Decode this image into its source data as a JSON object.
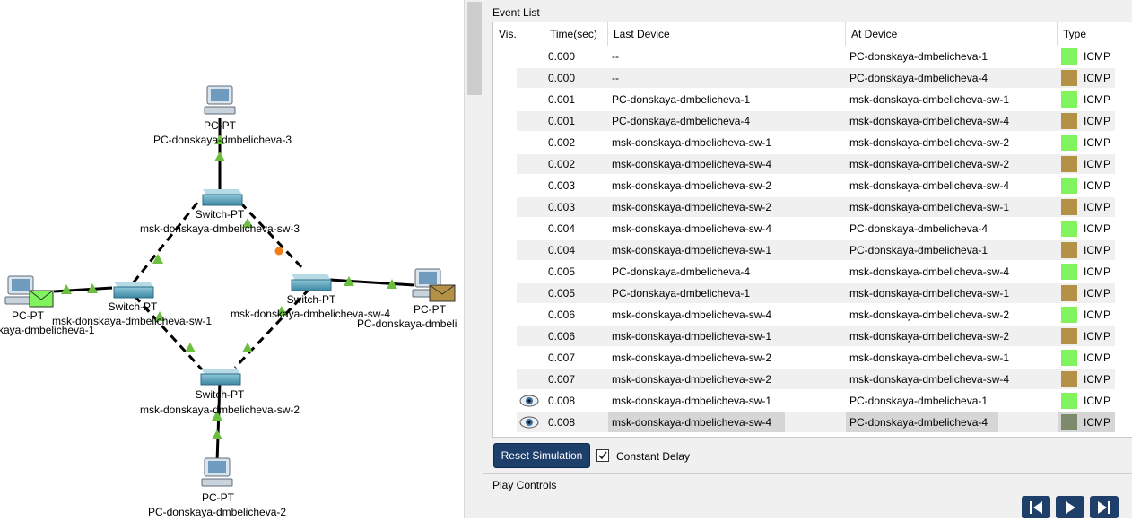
{
  "topology": {
    "devices": [
      {
        "kind": "pc",
        "type_label": "PC-PT",
        "name": "PC-donskaya-dmbelicheva-3"
      },
      {
        "kind": "switch",
        "type_label": "Switch-PT",
        "name": "msk-donskaya-dmbelicheva-sw-3"
      },
      {
        "kind": "pc",
        "type_label": "PC-PT",
        "name": "kaya-dmbelicheva-1"
      },
      {
        "kind": "switch",
        "type_label": "Switch-PT",
        "name": "msk-donskaya-dmbelicheva-sw-1"
      },
      {
        "kind": "switch",
        "type_label": "Switch-PT",
        "name": "msk-donskaya-dmbelicheva-sw-4"
      },
      {
        "kind": "pc",
        "type_label": "PC-PT",
        "name": "PC-donskaya-dmbeli"
      },
      {
        "kind": "switch",
        "type_label": "Switch-PT",
        "name": "msk-donskaya-dmbelicheva-sw-2"
      },
      {
        "kind": "pc",
        "type_label": "PC-PT",
        "name": "PC-donskaya-dmbelicheva-2"
      }
    ]
  },
  "event_list": {
    "title": "Event List",
    "columns": [
      "Vis.",
      "Time(sec)",
      "Last Device",
      "At Device",
      "Type"
    ],
    "rows": [
      {
        "eye": false,
        "time": "0.000",
        "last": "--",
        "at": "PC-donskaya-dmbelicheva-1",
        "color": "#80f45c",
        "type": "ICMP"
      },
      {
        "eye": false,
        "time": "0.000",
        "last": "--",
        "at": "PC-donskaya-dmbelicheva-4",
        "color": "#b39145",
        "type": "ICMP"
      },
      {
        "eye": false,
        "time": "0.001",
        "last": "PC-donskaya-dmbelicheva-1",
        "at": "msk-donskaya-dmbelicheva-sw-1",
        "color": "#80f45c",
        "type": "ICMP"
      },
      {
        "eye": false,
        "time": "0.001",
        "last": "PC-donskaya-dmbelicheva-4",
        "at": "msk-donskaya-dmbelicheva-sw-4",
        "color": "#b39145",
        "type": "ICMP"
      },
      {
        "eye": false,
        "time": "0.002",
        "last": "msk-donskaya-dmbelicheva-sw-1",
        "at": "msk-donskaya-dmbelicheva-sw-2",
        "color": "#80f45c",
        "type": "ICMP"
      },
      {
        "eye": false,
        "time": "0.002",
        "last": "msk-donskaya-dmbelicheva-sw-4",
        "at": "msk-donskaya-dmbelicheva-sw-2",
        "color": "#b39145",
        "type": "ICMP"
      },
      {
        "eye": false,
        "time": "0.003",
        "last": "msk-donskaya-dmbelicheva-sw-2",
        "at": "msk-donskaya-dmbelicheva-sw-4",
        "color": "#80f45c",
        "type": "ICMP"
      },
      {
        "eye": false,
        "time": "0.003",
        "last": "msk-donskaya-dmbelicheva-sw-2",
        "at": "msk-donskaya-dmbelicheva-sw-1",
        "color": "#b39145",
        "type": "ICMP"
      },
      {
        "eye": false,
        "time": "0.004",
        "last": "msk-donskaya-dmbelicheva-sw-4",
        "at": "PC-donskaya-dmbelicheva-4",
        "color": "#80f45c",
        "type": "ICMP"
      },
      {
        "eye": false,
        "time": "0.004",
        "last": "msk-donskaya-dmbelicheva-sw-1",
        "at": "PC-donskaya-dmbelicheva-1",
        "color": "#b39145",
        "type": "ICMP"
      },
      {
        "eye": false,
        "time": "0.005",
        "last": "PC-donskaya-dmbelicheva-4",
        "at": "msk-donskaya-dmbelicheva-sw-4",
        "color": "#80f45c",
        "type": "ICMP"
      },
      {
        "eye": false,
        "time": "0.005",
        "last": "PC-donskaya-dmbelicheva-1",
        "at": "msk-donskaya-dmbelicheva-sw-1",
        "color": "#b39145",
        "type": "ICMP"
      },
      {
        "eye": false,
        "time": "0.006",
        "last": "msk-donskaya-dmbelicheva-sw-4",
        "at": "msk-donskaya-dmbelicheva-sw-2",
        "color": "#80f45c",
        "type": "ICMP"
      },
      {
        "eye": false,
        "time": "0.006",
        "last": "msk-donskaya-dmbelicheva-sw-1",
        "at": "msk-donskaya-dmbelicheva-sw-2",
        "color": "#b39145",
        "type": "ICMP"
      },
      {
        "eye": false,
        "time": "0.007",
        "last": "msk-donskaya-dmbelicheva-sw-2",
        "at": "msk-donskaya-dmbelicheva-sw-1",
        "color": "#80f45c",
        "type": "ICMP"
      },
      {
        "eye": false,
        "time": "0.007",
        "last": "msk-donskaya-dmbelicheva-sw-2",
        "at": "msk-donskaya-dmbelicheva-sw-4",
        "color": "#b39145",
        "type": "ICMP"
      },
      {
        "eye": true,
        "time": "0.008",
        "last": "msk-donskaya-dmbelicheva-sw-1",
        "at": "PC-donskaya-dmbelicheva-1",
        "color": "#80f45c",
        "type": "ICMP"
      },
      {
        "eye": true,
        "time": "0.008",
        "last": "msk-donskaya-dmbelicheva-sw-4",
        "at": "PC-donskaya-dmbelicheva-4",
        "color": "#7e8a6c",
        "type": "ICMP",
        "selected": true
      }
    ]
  },
  "controls": {
    "reset_label": "Reset Simulation",
    "constant_delay_label": "Constant Delay",
    "constant_delay_checked": true,
    "play_controls_title": "Play Controls",
    "play_buttons": [
      "back-step",
      "play",
      "forward-step"
    ]
  },
  "colors": {
    "pdu_green": "#80f45c",
    "pdu_gold": "#b39145",
    "button_navy": "#1f3f6b",
    "link_arrow": "#6cbf3e",
    "pdu_dot": "#f07d1a"
  },
  "icons": [
    "pc-icon",
    "switch-icon",
    "envelope-icon",
    "eye-icon",
    "checkmark-icon",
    "step-back-icon",
    "play-icon",
    "step-forward-icon"
  ]
}
